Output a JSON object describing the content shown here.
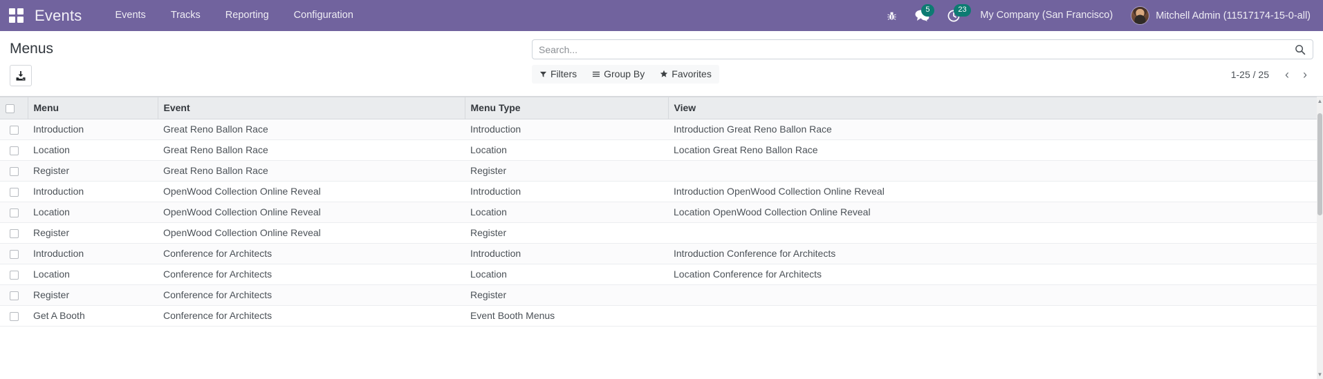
{
  "navbar": {
    "apps_icon": "grid-apps-icon",
    "brand": "Events",
    "menu_items": [
      {
        "label": "Events"
      },
      {
        "label": "Tracks"
      },
      {
        "label": "Reporting"
      },
      {
        "label": "Configuration"
      }
    ],
    "system_icons": [
      {
        "name": "bug-icon",
        "badge": ""
      },
      {
        "name": "messages-icon",
        "badge": "5"
      },
      {
        "name": "activities-clock-icon",
        "badge": "23"
      }
    ],
    "company": "My Company (San Francisco)",
    "user_name": "Mitchell Admin (11517174-15-0-all)",
    "accent_color": "#71639e",
    "badge_color": "#0d7b72"
  },
  "control_panel": {
    "title": "Menus",
    "import_button_label": "Import records",
    "search": {
      "placeholder": "Search...",
      "value": ""
    },
    "dropdowns": [
      {
        "label": "Filters",
        "icon": "filter-funnel-icon"
      },
      {
        "label": "Group By",
        "icon": "group-by-lines-icon"
      },
      {
        "label": "Favorites",
        "icon": "star-icon"
      }
    ],
    "pager": {
      "value": "1-25 / 25",
      "previous_label": "‹",
      "next_label": "›"
    }
  },
  "table": {
    "columns": [
      "Menu",
      "Event",
      "Menu Type",
      "View"
    ],
    "rows": [
      {
        "menu": "Introduction",
        "event": "Great Reno Ballon Race",
        "menu_type": "Introduction",
        "view": "Introduction Great Reno Ballon Race"
      },
      {
        "menu": "Location",
        "event": "Great Reno Ballon Race",
        "menu_type": "Location",
        "view": "Location Great Reno Ballon Race"
      },
      {
        "menu": "Register",
        "event": "Great Reno Ballon Race",
        "menu_type": "Register",
        "view": ""
      },
      {
        "menu": "Introduction",
        "event": "OpenWood Collection Online Reveal",
        "menu_type": "Introduction",
        "view": "Introduction OpenWood Collection Online Reveal"
      },
      {
        "menu": "Location",
        "event": "OpenWood Collection Online Reveal",
        "menu_type": "Location",
        "view": "Location OpenWood Collection Online Reveal"
      },
      {
        "menu": "Register",
        "event": "OpenWood Collection Online Reveal",
        "menu_type": "Register",
        "view": ""
      },
      {
        "menu": "Introduction",
        "event": "Conference for Architects",
        "menu_type": "Introduction",
        "view": "Introduction Conference for Architects"
      },
      {
        "menu": "Location",
        "event": "Conference for Architects",
        "menu_type": "Location",
        "view": "Location Conference for Architects"
      },
      {
        "menu": "Register",
        "event": "Conference for Architects",
        "menu_type": "Register",
        "view": ""
      },
      {
        "menu": "Get A Booth",
        "event": "Conference for Architects",
        "menu_type": "Event Booth Menus",
        "view": ""
      }
    ]
  }
}
